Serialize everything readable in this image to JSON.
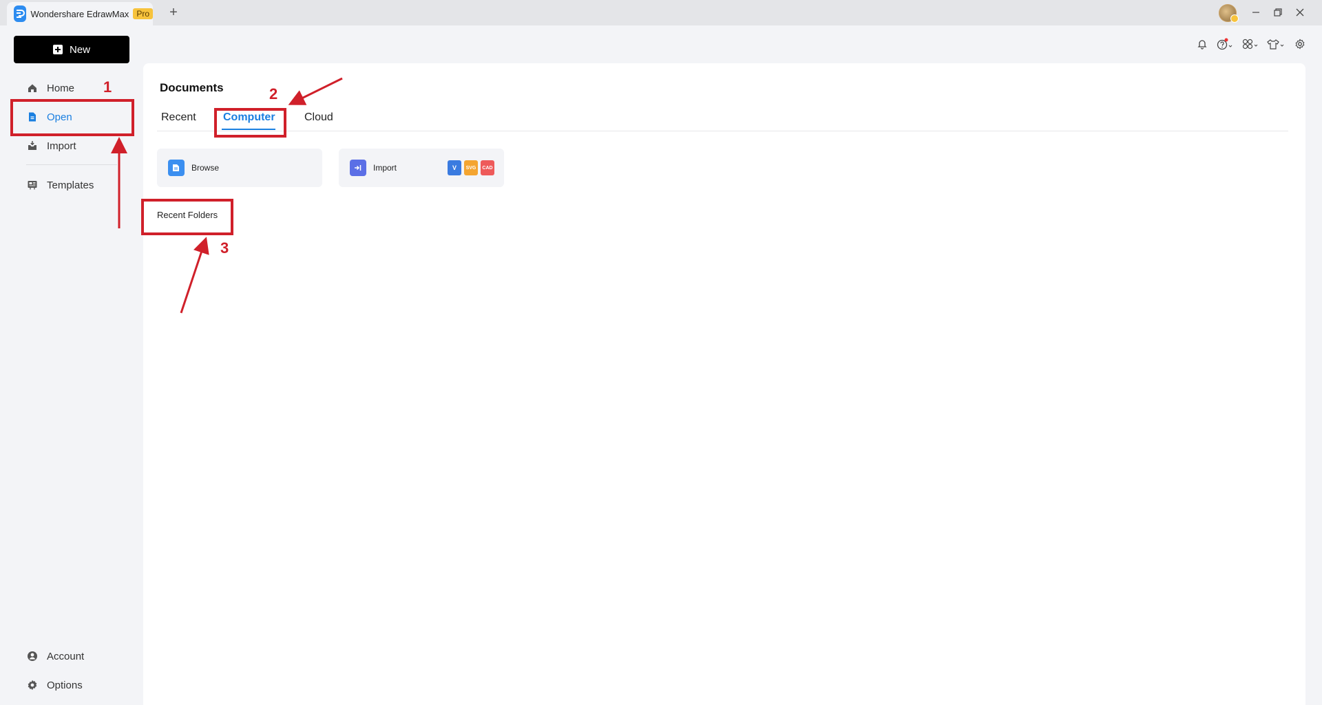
{
  "window": {
    "app_title": "Wondershare EdrawMax",
    "badge": "Pro",
    "new_tab": "+"
  },
  "sidebar": {
    "new_label": "New",
    "items": [
      {
        "label": "Home",
        "icon": "home-icon"
      },
      {
        "label": "Open",
        "icon": "file-icon",
        "active": true
      },
      {
        "label": "Import",
        "icon": "import-icon"
      },
      {
        "label": "Templates",
        "icon": "templates-icon"
      }
    ],
    "bottom": [
      {
        "label": "Account",
        "icon": "account-icon"
      },
      {
        "label": "Options",
        "icon": "gear-icon"
      }
    ]
  },
  "main": {
    "title": "Documents",
    "tabs": [
      {
        "label": "Recent"
      },
      {
        "label": "Computer",
        "active": true
      },
      {
        "label": "Cloud"
      }
    ],
    "cards": {
      "browse_label": "Browse",
      "import_label": "Import",
      "file_types": [
        "V",
        "SVG",
        "CAD"
      ]
    },
    "recent_folders_label": "Recent Folders"
  },
  "annotations": {
    "numbers": [
      "1",
      "2",
      "3"
    ]
  },
  "colors": {
    "accent": "#1a7fe0",
    "annotation": "#d0202a",
    "pro_badge": "#f7c33c"
  }
}
